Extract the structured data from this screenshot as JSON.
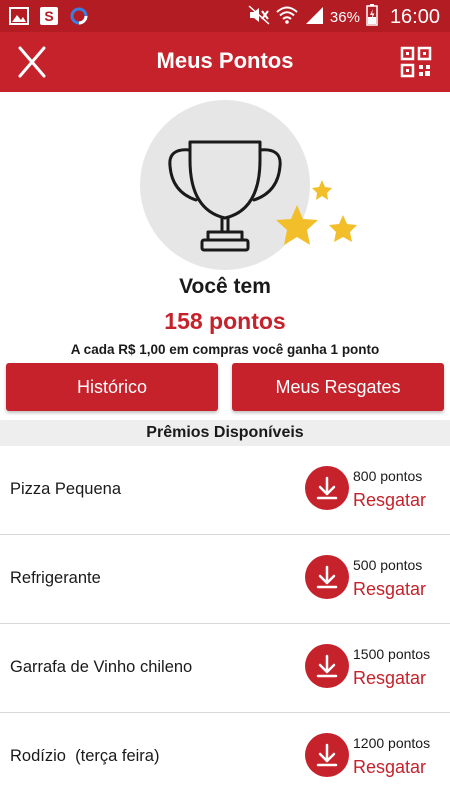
{
  "status_bar": {
    "battery_pct": "36%",
    "time": "16:00",
    "left_icons": [
      "image-icon",
      "s-app-icon",
      "sync-icon"
    ],
    "right_icons": [
      "mute-icon",
      "wifi-icon",
      "signal-icon",
      "battery-icon"
    ]
  },
  "app_bar": {
    "title": "Meus Pontos",
    "close_icon": "close-icon",
    "qr_icon": "qr-code-icon"
  },
  "summary": {
    "you_have": "Você tem",
    "points": "158 pontos",
    "info": "A cada R$ 1,00 em compras você ganha 1 ponto"
  },
  "buttons": {
    "history": "Histórico",
    "redemptions": "Meus Resgates"
  },
  "prizes_header": "Prêmios Disponíveis",
  "prizes": [
    {
      "name": "Pizza Pequena",
      "points": "800 pontos",
      "action": "Resgatar"
    },
    {
      "name": "Refrigerante",
      "points": "500 pontos",
      "action": "Resgatar"
    },
    {
      "name": "Garrafa de Vinho chileno",
      "points": "1500 pontos",
      "action": "Resgatar"
    },
    {
      "name": "Rodízio  (terça feira)",
      "points": "1200 pontos",
      "action": "Resgatar"
    }
  ],
  "colors": {
    "primary": "#c5222b",
    "status_bar": "#b31c22",
    "star": "#f2bf2a",
    "circle_bg": "#e6e6e6"
  }
}
